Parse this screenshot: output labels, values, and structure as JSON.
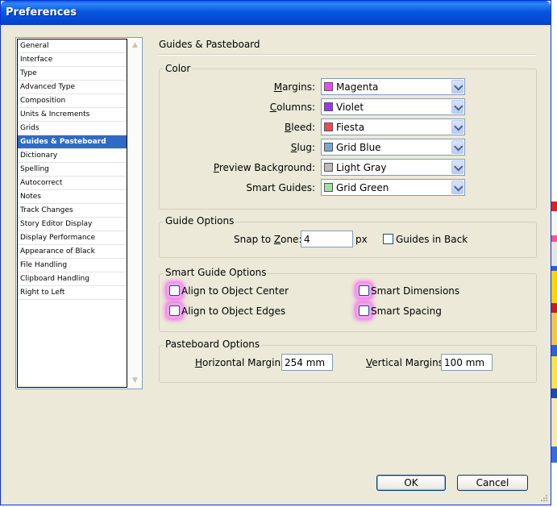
{
  "window": {
    "title": "Preferences"
  },
  "nav": {
    "items": [
      "General",
      "Interface",
      "Type",
      "Advanced Type",
      "Composition",
      "Units & Increments",
      "Grids",
      "Guides & Pasteboard",
      "Dictionary",
      "Spelling",
      "Autocorrect",
      "Notes",
      "Track Changes",
      "Story Editor Display",
      "Display Performance",
      "Appearance of Black",
      "File Handling",
      "Clipboard Handling",
      "Right to Left"
    ],
    "selected_index": 7
  },
  "panel": {
    "title": "Guides & Pasteboard",
    "color": {
      "title": "Color",
      "rows": [
        {
          "label": "Margins:",
          "value": "Magenta",
          "color": "#ff40ff"
        },
        {
          "label": "Columns:",
          "value": "Violet",
          "color": "#9933ff"
        },
        {
          "label": "Bleed:",
          "value": "Fiesta",
          "color": "#f2465a"
        },
        {
          "label": "Slug:",
          "value": "Grid Blue",
          "color": "#7aa6d6"
        },
        {
          "label": "Preview Background:",
          "value": "Light Gray",
          "color": "#bababa"
        },
        {
          "label": "Smart Guides:",
          "value": "Grid Green",
          "color": "#9fe09f"
        }
      ]
    },
    "guide_options": {
      "title": "Guide Options",
      "snap_label": "Snap to Zone:",
      "snap_value": "4",
      "snap_unit": "px",
      "guides_in_back_label": "Guides in Back",
      "guides_in_back_checked": false
    },
    "smart_guide_options": {
      "title": "Smart Guide Options",
      "align_center_label": "Align to Object Center",
      "align_edges_label": "Align to Object Edges",
      "smart_dimensions_label": "Smart Dimensions",
      "smart_spacing_label": "Smart Spacing",
      "highlight_color": "#ee66ee"
    },
    "pasteboard_options": {
      "title": "Pasteboard Options",
      "horizontal_label": "Horizontal Margins:",
      "horizontal_value": "254 mm",
      "vertical_label": "Vertical Margins:",
      "vertical_value": "100 mm"
    }
  },
  "buttons": {
    "ok": "OK",
    "cancel": "Cancel"
  },
  "colors": {
    "selection": "#316ac5",
    "titlebar": "#0857e0",
    "dialog_bg": "#ece9d8"
  }
}
